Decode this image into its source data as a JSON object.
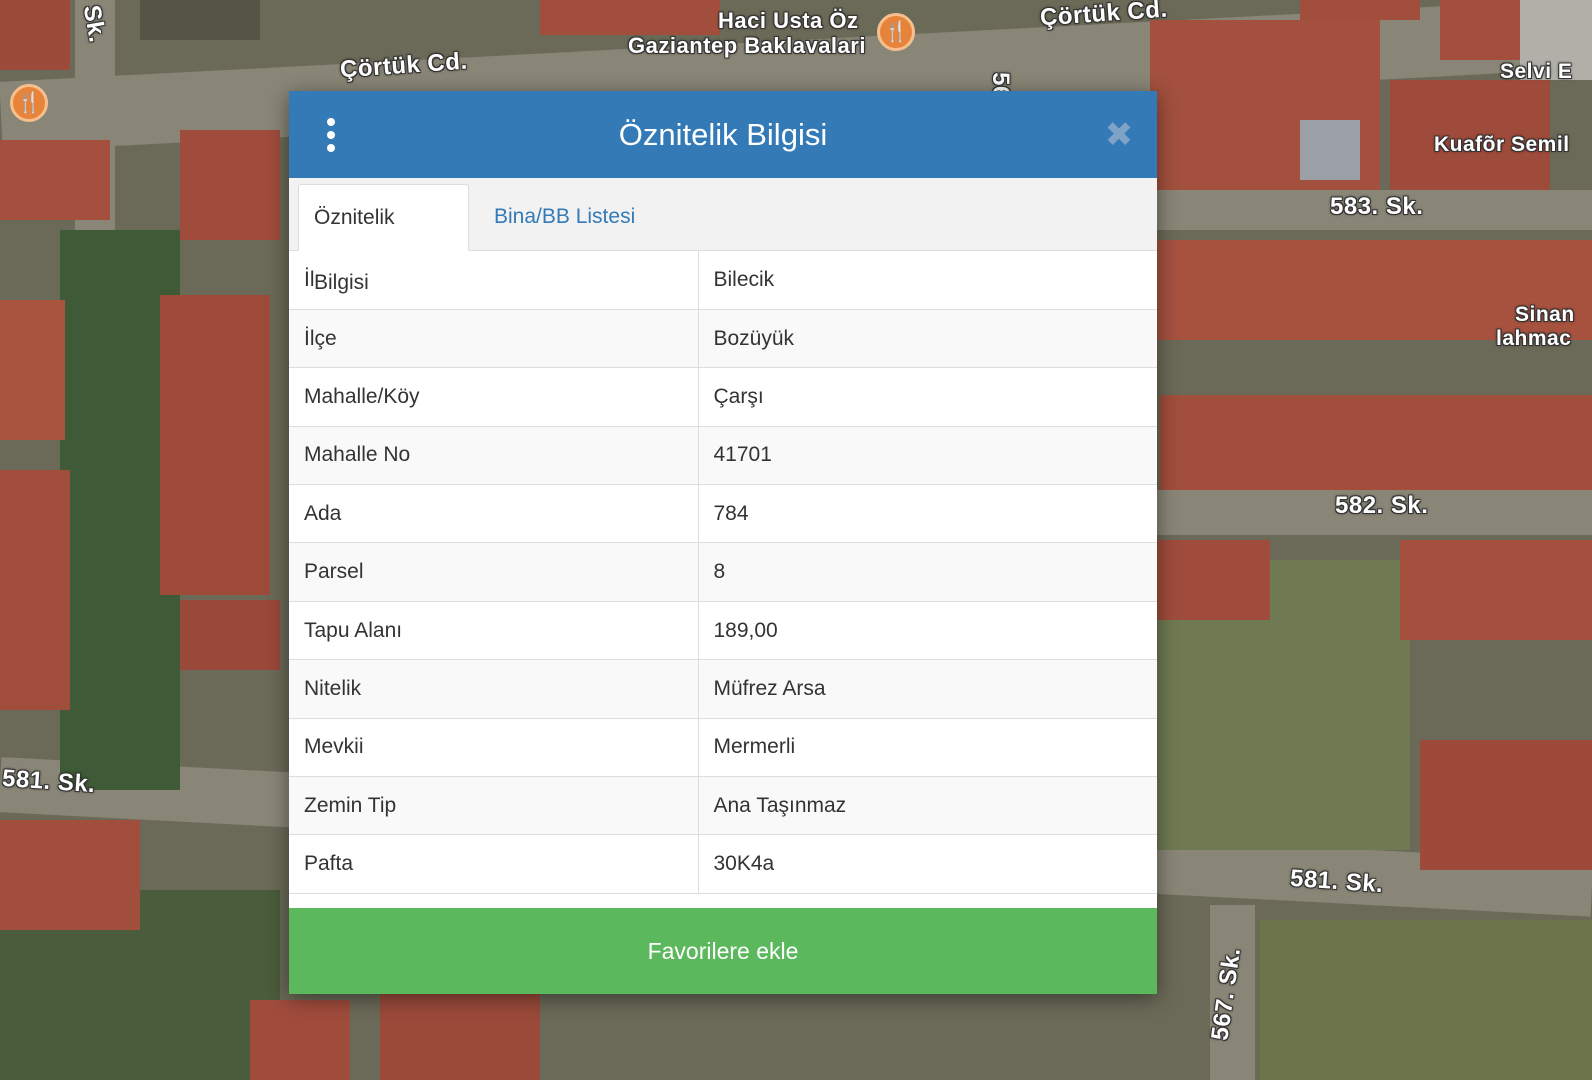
{
  "map": {
    "labels": [
      {
        "text": "Çörtük Cd."
      },
      {
        "text": "Haci Usta Öz"
      },
      {
        "text": "Gaziantep Baklavalari"
      },
      {
        "text": "583. Sk."
      },
      {
        "text": "582. Sk."
      },
      {
        "text": "581. Sk."
      },
      {
        "text": "581. Sk."
      },
      {
        "text": "567. Sk."
      },
      {
        "text": "Selvi E"
      },
      {
        "text": "Kuafõr Semil"
      },
      {
        "text": "Sinan"
      },
      {
        "text": "lahmac"
      },
      {
        "text": "Sk."
      },
      {
        "text": "56"
      },
      {
        "text": "Çörtük Cd."
      }
    ],
    "poi_icon": "restaurant-icon"
  },
  "dialog": {
    "title": "Öznitelik Bilgisi",
    "menu_icon": "vertical-dots-icon",
    "close_icon": "close-icon",
    "close_symbol": "✖",
    "tabs": [
      {
        "label": "Öznitelik Bilgisi",
        "active": true
      },
      {
        "label": "Bina/BB Listesi",
        "active": false
      }
    ],
    "rows": [
      {
        "label": "İl",
        "value": "Bilecik"
      },
      {
        "label": "İlçe",
        "value": "Bozüyük"
      },
      {
        "label": "Mahalle/Köy",
        "value": "Çarşı"
      },
      {
        "label": "Mahalle No",
        "value": "41701"
      },
      {
        "label": "Ada",
        "value": "784"
      },
      {
        "label": "Parsel",
        "value": "8"
      },
      {
        "label": "Tapu Alanı",
        "value": "189,00"
      },
      {
        "label": "Nitelik",
        "value": "Müfrez Arsa"
      },
      {
        "label": "Mevkii",
        "value": "Mermerli"
      },
      {
        "label": "Zemin Tip",
        "value": "Ana Taşınmaz"
      },
      {
        "label": "Pafta",
        "value": "30K4a"
      }
    ],
    "favorite_label": "Favorilere ekle"
  },
  "colors": {
    "header": "#337ab7",
    "favorite": "#5cb85c",
    "link": "#337ab7"
  }
}
